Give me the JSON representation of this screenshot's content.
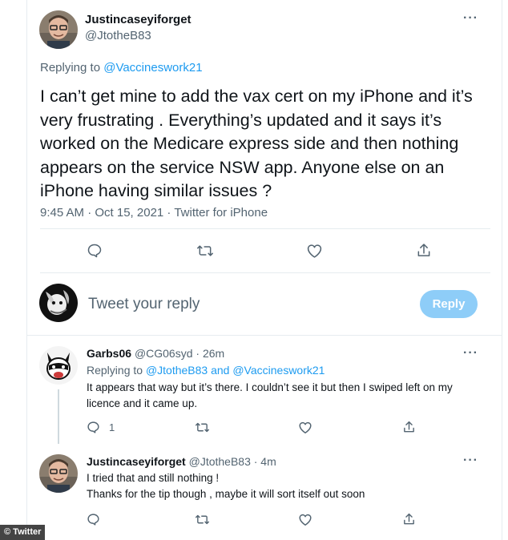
{
  "main_tweet": {
    "display_name": "Justincaseyiforget",
    "handle": "@JtotheB83",
    "more_label": "···",
    "replying_prefix": "Replying to",
    "replying_to": "@Vaccineswork21",
    "text": "I can’t get mine to add the vax cert on my iPhone and it’s very frustrating . Everything’s updated and it says it’s worked on the Medicare express side and then nothing appears on the service NSW app. Anyone else on an iPhone having similar issues ?",
    "meta": "9:45 AM · Oct 15, 2021 · Twitter for iPhone",
    "actions": [
      "reply-icon",
      "retweet-icon",
      "like-icon",
      "share-icon"
    ]
  },
  "composer": {
    "placeholder": "Tweet your reply",
    "button_label": "Reply"
  },
  "replies": [
    {
      "display_name": "Garbs06",
      "handle_time": "@CG06syd · 26m",
      "more_label": "···",
      "replying_prefix": "Replying to",
      "replying_to": "@JtotheB83 and @Vaccineswork21",
      "text": "It appears that way but it’s there. I couldn’t see it but then I swiped left on my licence and it came up.",
      "reply_count": "1"
    },
    {
      "display_name": "Justincaseyiforget",
      "handle_time": "@JtotheB83 · 4m",
      "more_label": "···",
      "line1": "I tried that and still nothing !",
      "line2": "Thanks for the tip though , maybe it will sort itself out soon"
    }
  ],
  "watermark": "© Twitter",
  "colors": {
    "accent": "#1d9bf0",
    "reply_button_disabled": "#8ecdf8",
    "secondary_text": "#536471",
    "divider": "#e6ecf0"
  }
}
